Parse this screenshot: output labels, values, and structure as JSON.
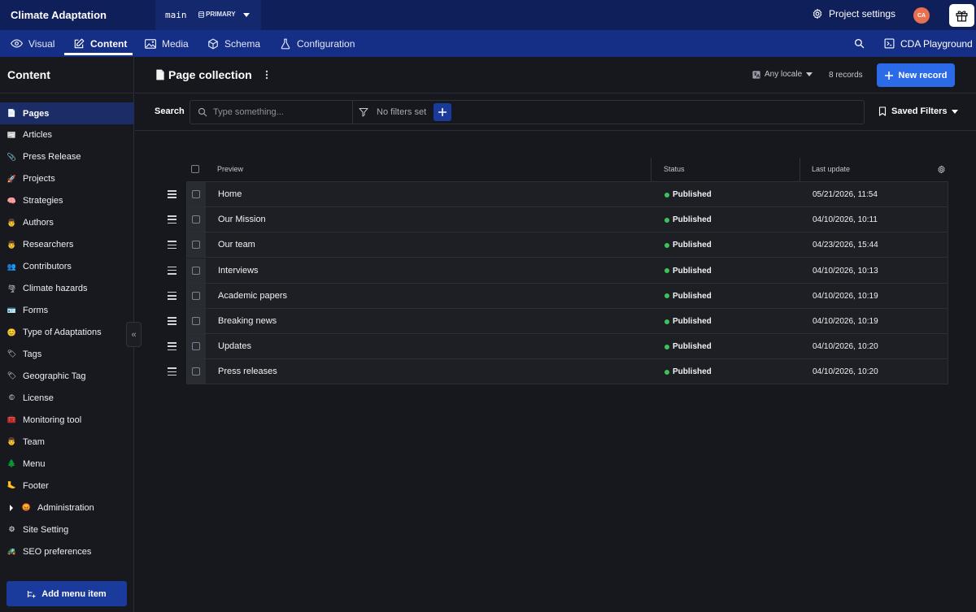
{
  "app": {
    "title": "Climate Adaptation",
    "environment": "main",
    "environment_badge": "PRIMARY",
    "project_settings": "Project settings",
    "avatar_initials": "CA"
  },
  "nav": {
    "tabs": [
      {
        "label": "Visual",
        "icon": "eye-icon"
      },
      {
        "label": "Content",
        "icon": "edit-icon",
        "active": true
      },
      {
        "label": "Media",
        "icon": "image-icon"
      },
      {
        "label": "Schema",
        "icon": "cube-icon"
      },
      {
        "label": "Configuration",
        "icon": "flask-icon"
      }
    ],
    "playground": "CDA Playground"
  },
  "sidebar": {
    "title": "Content",
    "items": [
      {
        "label": "Pages",
        "emoji": "📄",
        "active": true
      },
      {
        "label": "Articles",
        "emoji": "📰"
      },
      {
        "label": "Press Release",
        "emoji": "📎"
      },
      {
        "label": "Projects",
        "emoji": "🚀"
      },
      {
        "label": "Strategies",
        "emoji": "🧠"
      },
      {
        "label": "Authors",
        "emoji": "👨"
      },
      {
        "label": "Researchers",
        "emoji": "👨"
      },
      {
        "label": "Contributors",
        "emoji": "👥"
      },
      {
        "label": "Climate hazards",
        "emoji": "🌪"
      },
      {
        "label": "Forms",
        "emoji": "🪪"
      },
      {
        "label": "Type of Adaptations",
        "emoji": "😊"
      },
      {
        "label": "Tags",
        "emoji": "🏷"
      },
      {
        "label": "Geographic Tag",
        "emoji": "🏷"
      },
      {
        "label": "License",
        "emoji": "©"
      },
      {
        "label": "Monitoring tool",
        "emoji": "🧰"
      },
      {
        "label": "Team",
        "emoji": "👨"
      },
      {
        "label": "Menu",
        "emoji": "🌲"
      },
      {
        "label": "Footer",
        "emoji": "🦶"
      },
      {
        "label": "Administration",
        "emoji": "😡",
        "expandable": true
      },
      {
        "label": "Site Setting",
        "emoji": "⚙"
      },
      {
        "label": "SEO preferences",
        "emoji": "🚜"
      }
    ],
    "add_menu_item": "Add menu item"
  },
  "collection": {
    "title": "Page collection",
    "locale": "Any locale",
    "records_count": "8 records",
    "new_record": "New record"
  },
  "search": {
    "label": "Search",
    "placeholder": "Type something...",
    "filters_text": "No filters set",
    "saved_filters": "Saved Filters"
  },
  "table": {
    "headers": {
      "preview": "Preview",
      "status": "Status",
      "last_update": "Last update"
    },
    "rows": [
      {
        "title": "Home",
        "status": "Published",
        "date": "05/21/2026, 11:54"
      },
      {
        "title": "Our Mission",
        "status": "Published",
        "date": "04/10/2026, 10:11"
      },
      {
        "title": "Our team",
        "status": "Published",
        "date": "04/23/2026, 15:44"
      },
      {
        "title": "Interviews",
        "status": "Published",
        "date": "04/10/2026, 10:13"
      },
      {
        "title": "Academic papers",
        "status": "Published",
        "date": "04/10/2026, 10:19"
      },
      {
        "title": "Breaking news",
        "status": "Published",
        "date": "04/10/2026, 10:19"
      },
      {
        "title": "Updates",
        "status": "Published",
        "date": "04/10/2026, 10:20"
      },
      {
        "title": "Press releases",
        "status": "Published",
        "date": "04/10/2026, 10:20"
      }
    ]
  },
  "colors": {
    "topbar": "#0e1f5a",
    "navbar": "#152e86",
    "primary_button": "#2c6be8",
    "published_dot": "#3bc45a"
  }
}
